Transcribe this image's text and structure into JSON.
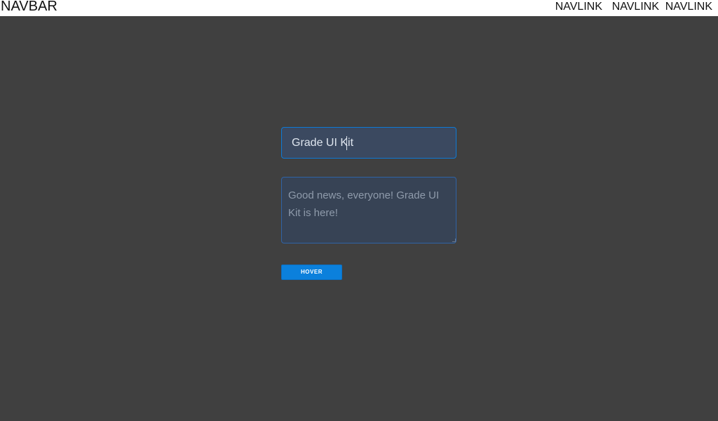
{
  "navbar": {
    "brand": "NAVBAR",
    "links": [
      "NAVLINK",
      "NAVLINK",
      "NAVLINK"
    ]
  },
  "form": {
    "title_input_value": "Grade UI Kit",
    "message_textarea_value": "Good news, everyone! Grade UI Kit is here!",
    "hover_button_label": "HOVER"
  },
  "colors": {
    "background": "#404040",
    "navbar": "#ffffff",
    "input_background": "#3b4960",
    "input_border_focus": "#0e7ad6",
    "textarea_background": "#374355",
    "button_background": "#0b80dc"
  }
}
